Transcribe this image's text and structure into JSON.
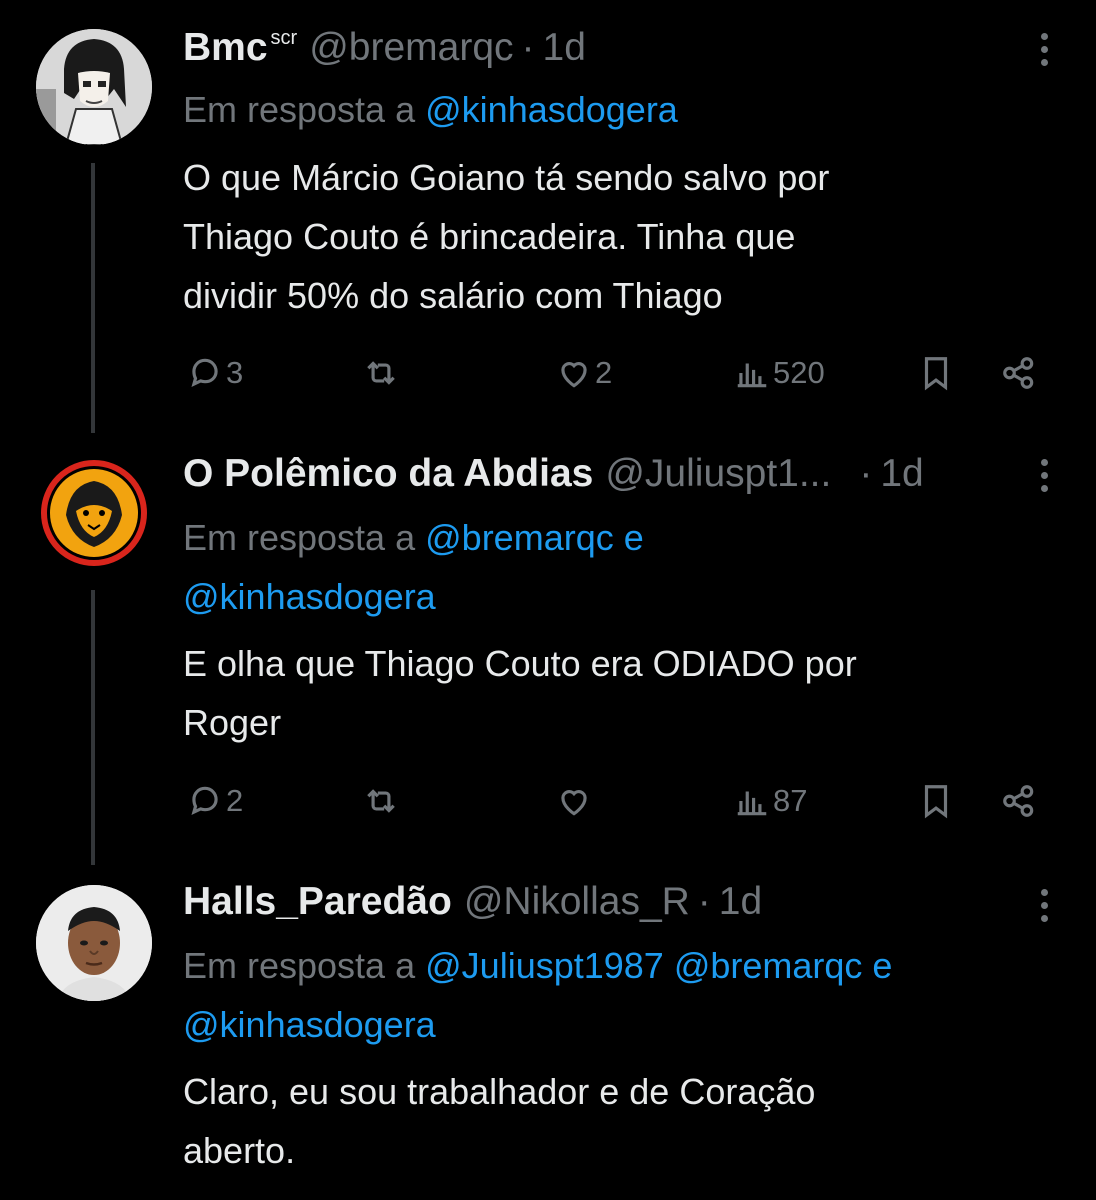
{
  "tweets": [
    {
      "name": "Bmc",
      "badge": "scr",
      "handle": "@bremarqc",
      "time": "1d",
      "reply_prefix": "Em resposta a",
      "reply_mentions_line1": "@kinhasdogera",
      "reply_mentions_line2": "",
      "text": [
        "O que Márcio Goiano tá sendo salvo por",
        "Thiago Couto é brincadeira. Tinha que",
        "dividir 50% do salário com Thiago"
      ],
      "replies": "3",
      "retweets": "",
      "likes": "2",
      "views": "520"
    },
    {
      "name": "O Polêmico da Abdias",
      "badge": "",
      "handle": "@Juliuspt1...",
      "time": "1d",
      "reply_prefix": "Em resposta a",
      "reply_mentions_line1": "@bremarqc e",
      "reply_mentions_line2": "@kinhasdogera",
      "text": [
        "E olha que Thiago Couto era ODIADO por",
        "Roger"
      ],
      "replies": "2",
      "retweets": "",
      "likes": "",
      "views": "87"
    },
    {
      "name": "Halls_Paredão",
      "badge": "",
      "handle": "@Nikollas_R",
      "time": "1d",
      "reply_prefix": "Em resposta a",
      "reply_mentions_line1": "@Juliuspt1987 @bremarqc e",
      "reply_mentions_line2": "@kinhasdogera",
      "text": [
        "Claro, eu sou trabalhador e de Coração",
        "aberto."
      ],
      "replies": "",
      "retweets": "",
      "likes": "",
      "views": ""
    }
  ],
  "separator": "·",
  "colors": {
    "background": "#000000",
    "text": "#e7e9ea",
    "muted": "#71767b",
    "link": "#1d9bf0",
    "thread_line": "#333639"
  },
  "icons": [
    "reply-icon",
    "retweet-icon",
    "like-icon",
    "views-icon",
    "bookmark-icon",
    "share-icon",
    "more-icon"
  ]
}
